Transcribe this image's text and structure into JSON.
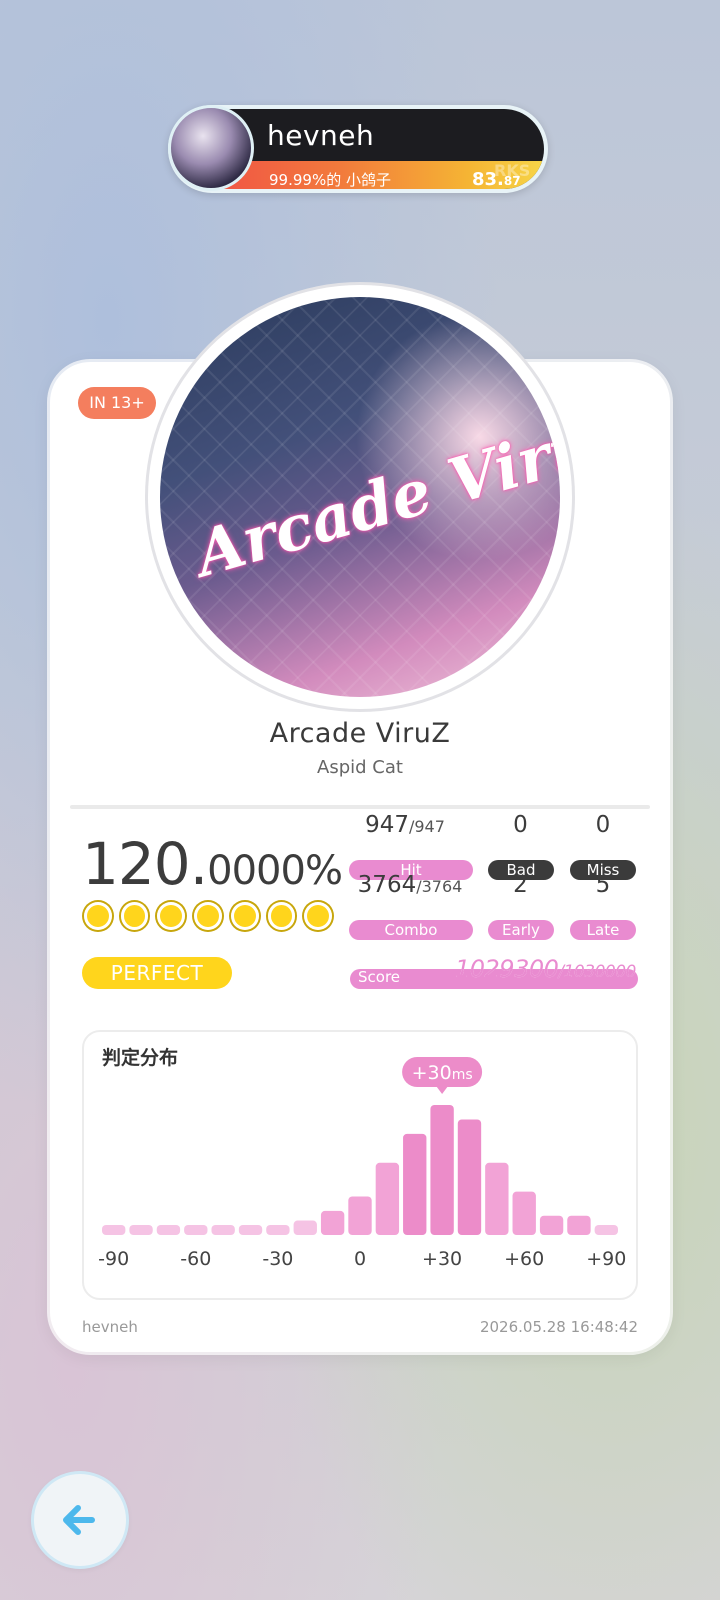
{
  "player": {
    "name": "hevneh",
    "title": "99.99%的 小鸽子",
    "rks_label": "RKS",
    "rks_int": "83.",
    "rks_dec": "87"
  },
  "song": {
    "level": "IN 13+",
    "title": "Arcade ViruZ",
    "artist": "Aspid Cat",
    "cover_text": "Arcade ViruZ"
  },
  "result": {
    "accuracy_int": "120.",
    "accuracy_dec": "0000%",
    "stars": 7,
    "rank": "PERFECT",
    "hit": {
      "value": "947",
      "total": "/947",
      "label": "Hit"
    },
    "combo": {
      "value": "3764",
      "total": "/3764",
      "label": "Combo"
    },
    "bad": {
      "value": "0",
      "label": "Bad"
    },
    "miss": {
      "value": "0",
      "label": "Miss"
    },
    "early": {
      "value": "2",
      "label": "Early"
    },
    "late": {
      "value": "5",
      "label": "Late"
    },
    "score_label": "Score",
    "score": "1029300",
    "score_max": "/1030000"
  },
  "chart_data": {
    "type": "bar",
    "title": "判定分布",
    "x_tick_labels": [
      "-90",
      "-60",
      "-30",
      "0",
      "+30",
      "+60",
      "+90"
    ],
    "values": [
      2,
      2,
      2,
      2,
      2,
      2,
      2,
      3,
      5,
      8,
      15,
      21,
      27,
      24,
      15,
      9,
      4,
      4,
      2
    ],
    "peak_label_value": "+30",
    "peak_label_unit": "ms",
    "bar_color": "#f2a3d6",
    "bar_color_light": "#f5c3e4",
    "bar_color_dark": "#ec8cc9"
  },
  "footer": {
    "user": "hevneh",
    "timestamp": "2026.05.28 16:48:42"
  },
  "colors": {
    "accent_pink": "#e98bd0",
    "gold": "#ffd51c",
    "level_badge": "#f47e5e",
    "back_arrow": "#4db8ec"
  },
  "nav": {
    "back_icon": "arrow-left-icon"
  }
}
